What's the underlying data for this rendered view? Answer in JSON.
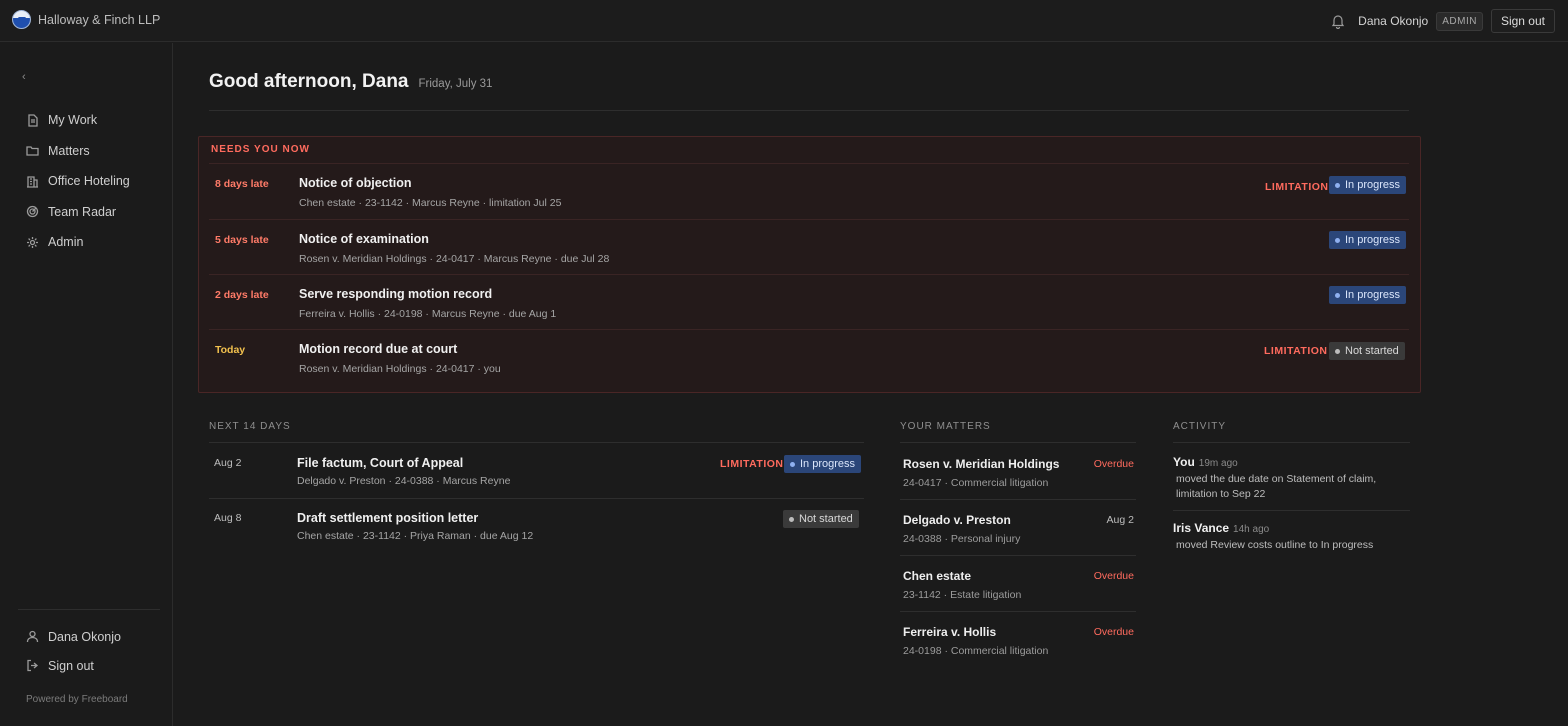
{
  "app": {
    "firm_name": "Halloway & Finch LLP",
    "user_name": "Dana Okonjo",
    "role_badge": "ADMIN",
    "sign_out": "Sign out",
    "collapse_glyph": "‹"
  },
  "sidebar": {
    "items": [
      {
        "label": "My Work",
        "icon": "document-icon"
      },
      {
        "label": "Matters",
        "icon": "folder-icon"
      },
      {
        "label": "Office Hoteling",
        "icon": "building-icon"
      },
      {
        "label": "Team Radar",
        "icon": "radar-icon"
      },
      {
        "label": "Admin",
        "icon": "gear-icon"
      }
    ],
    "bottom": [
      {
        "label": "Dana Okonjo",
        "icon": "user-icon"
      },
      {
        "label": "Sign out",
        "icon": "sign-out-icon"
      }
    ],
    "powered_by": "Powered by Freeboard"
  },
  "header": {
    "greeting": "Good afternoon, Dana",
    "date": "Friday, July 31"
  },
  "needs_you_now": {
    "title": "NEEDS YOU NOW",
    "rows": [
      {
        "late": "8 days late",
        "title": "Notice of objection",
        "meta": "Chen estate · 23-1142 · Marcus Reyne · limitation Jul 25",
        "limitation": "LIMITATION",
        "status": "In progress"
      },
      {
        "late": "5 days late",
        "title": "Notice of examination",
        "meta": "Rosen v. Meridian Holdings · 24-0417 · Marcus Reyne · due Jul 28",
        "limitation": "",
        "status": "In progress"
      },
      {
        "late": "2 days late",
        "title": "Serve responding motion record",
        "meta": "Ferreira v. Hollis · 24-0198 · Marcus Reyne · due Aug 1",
        "limitation": "",
        "status": "In progress"
      },
      {
        "late": "Today",
        "title": "Motion record due at court",
        "meta": "Rosen v. Meridian Holdings · 24-0417 · you",
        "limitation": "LIMITATION",
        "status": "Not started"
      }
    ]
  },
  "next_14_days": {
    "title": "NEXT 14 DAYS",
    "rows": [
      {
        "date": "Aug 2",
        "title": "File factum, Court of Appeal",
        "meta": "Delgado v. Preston · 24-0388 · Marcus Reyne",
        "limitation": "LIMITATION",
        "status": "In progress"
      },
      {
        "date": "Aug 8",
        "title": "Draft settlement position letter",
        "meta": "Chen estate · 23-1142 · Priya Raman · due Aug 12",
        "limitation": "",
        "status": "Not started"
      }
    ]
  },
  "your_matters": {
    "title": "YOUR MATTERS",
    "rows": [
      {
        "name": "Rosen v. Meridian Holdings",
        "sub": "24-0417 · Commercial litigation",
        "status": "Overdue"
      },
      {
        "name": "Delgado v. Preston",
        "sub": "24-0388 · Personal injury",
        "status": "Aug 2"
      },
      {
        "name": "Chen estate",
        "sub": "23-1142 · Estate litigation",
        "status": "Overdue"
      },
      {
        "name": "Ferreira v. Hollis",
        "sub": "24-0198 · Commercial litigation",
        "status": "Overdue"
      }
    ]
  },
  "activity": {
    "title": "ACTIVITY",
    "items": [
      {
        "who": "You",
        "time": "19m ago",
        "text": "moved the due date on Statement of claim, limitation to Sep 22"
      },
      {
        "who": "Iris Vance",
        "time": "14h ago",
        "text": "moved Review costs outline to In progress"
      }
    ]
  },
  "colors": {
    "accent_danger": "#ff6b5e",
    "in_progress": "#2b4679",
    "not_started": "#3a3a3a",
    "today": "#f2c14e"
  }
}
